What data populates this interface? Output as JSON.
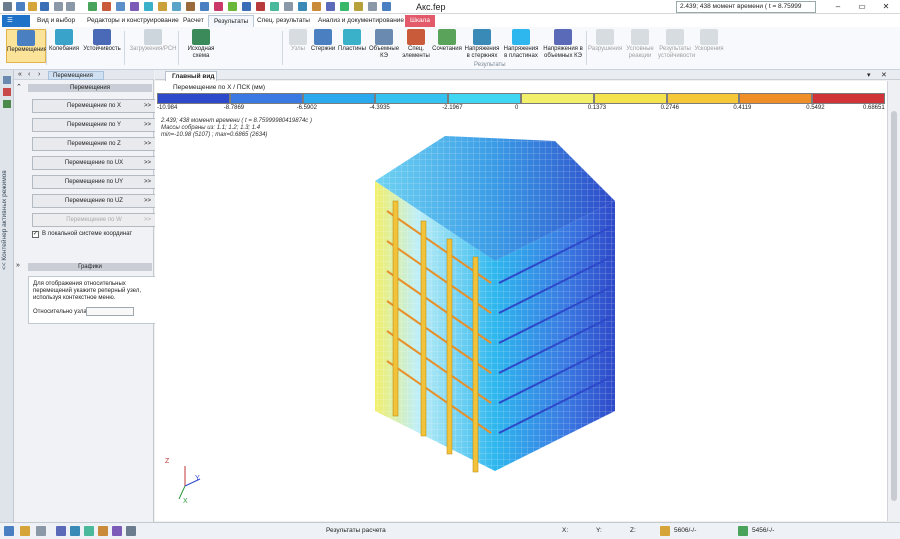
{
  "window": {
    "title": "Акс.fep",
    "time_combo": "2.439; 438 момент времени ( t = 8.75999",
    "minimize": "–",
    "restore": "▭",
    "close": "✕"
  },
  "tabs": [
    "Вид и выбор",
    "Редакторы и конструирование",
    "Расчет",
    "Результаты",
    "Спец. результаты",
    "Анализ и документирование",
    "Шкала"
  ],
  "tabs_active": "Результаты",
  "ribbon": {
    "buttons": [
      {
        "label": "Перемещения",
        "icon": "displacement-icon",
        "selected": true,
        "disabled": false
      },
      {
        "label": "Колебания",
        "icon": "oscillation-icon",
        "selected": false,
        "disabled": false
      },
      {
        "label": "Устойчивость",
        "icon": "stability-icon",
        "selected": false,
        "disabled": false
      },
      {
        "label": "Загружения/РСН",
        "icon": "loads-icon",
        "selected": false,
        "disabled": true
      },
      {
        "label": "Исходная схема",
        "icon": "source-scheme-icon",
        "selected": false,
        "disabled": false
      },
      {
        "label": "Узлы",
        "icon": "nodes-icon",
        "selected": false,
        "disabled": true
      },
      {
        "label": "Стержни",
        "icon": "bars-icon",
        "selected": false,
        "disabled": false
      },
      {
        "label": "Пластины",
        "icon": "plates-icon",
        "selected": false,
        "disabled": false
      },
      {
        "label": "Объемные КЭ",
        "icon": "volume-fe-icon",
        "selected": false,
        "disabled": false
      },
      {
        "label": "Спец. элементы",
        "icon": "special-elements-icon",
        "selected": false,
        "disabled": false
      },
      {
        "label": "Сочетания",
        "icon": "combinations-icon",
        "selected": false,
        "disabled": false
      },
      {
        "label": "Напряжения в стержнях",
        "icon": "bar-stress-icon",
        "selected": false,
        "disabled": false
      },
      {
        "label": "Напряжения в пластинах",
        "icon": "plate-stress-icon",
        "selected": false,
        "disabled": false
      },
      {
        "label": "Напряжения в объемных КЭ",
        "icon": "volume-stress-icon",
        "selected": false,
        "disabled": false
      },
      {
        "label": "Разрушения",
        "icon": "destruction-icon",
        "selected": false,
        "disabled": true
      },
      {
        "label": "Условные реакции",
        "icon": "reactions-icon",
        "selected": false,
        "disabled": true
      },
      {
        "label": "Результаты устойчивости",
        "icon": "stability-results-icon",
        "selected": false,
        "disabled": true
      },
      {
        "label": "Ускорения",
        "icon": "acceleration-icon",
        "selected": false,
        "disabled": true
      }
    ],
    "group_label": "Результаты"
  },
  "vstrip": {
    "label": "<< Контейнер активных режимов"
  },
  "panel": {
    "tab": "Перемещения",
    "section": "Перемещения",
    "buttons": [
      {
        "label": "Перемещение по X",
        "disabled": false
      },
      {
        "label": "Перемещение по Y",
        "disabled": false
      },
      {
        "label": "Перемещение по Z",
        "disabled": false
      },
      {
        "label": "Перемещение по UX",
        "disabled": false
      },
      {
        "label": "Перемещение по UY",
        "disabled": false
      },
      {
        "label": "Перемещение по UZ",
        "disabled": false
      },
      {
        "label": "Перемещение по W",
        "disabled": true
      }
    ],
    "checkbox": "В локальной системе координат",
    "graphs_section": "Графики",
    "graphs_text": "Для отображения относительных перемещений укажите реперный узел, используя контекстное меню.",
    "relative_label": "Относительно узла",
    "relative_value": ""
  },
  "view": {
    "tab": "Главный вид",
    "colorbar_title": "Перемещение по X / ПСК (мм)",
    "colorbar_labels": [
      "-10.984",
      "-8.7869",
      "-6.5902",
      "-4.3935",
      "-2.1967",
      "0",
      "0.1373",
      "0.2746",
      "0.4119",
      "0.5492",
      "0.68651"
    ],
    "colorbar_colors": [
      "#2e49c9",
      "#3a78e2",
      "#2aa9ee",
      "#34c3f0",
      "#3fd6f4",
      "#f2ef6a",
      "#f5e24f",
      "#f5c83a",
      "#ef8d27",
      "#d03438"
    ],
    "info_lines": [
      "2.439; 438 момент времени ( t = 8.75999980419874с )",
      "Массы собраны из: 1.1; 1.2; 1.3; 1.4",
      "min=-10.98 (5107) ; max=0.6865 (2634)"
    ],
    "axes": {
      "z": "Z",
      "y": "Y",
      "x": "X"
    }
  },
  "status": {
    "label": "Результаты расчета",
    "x": "X:",
    "y": "Y:",
    "z": "Z:",
    "nodes": "5606/-/-",
    "elements": "5456/-/-"
  }
}
